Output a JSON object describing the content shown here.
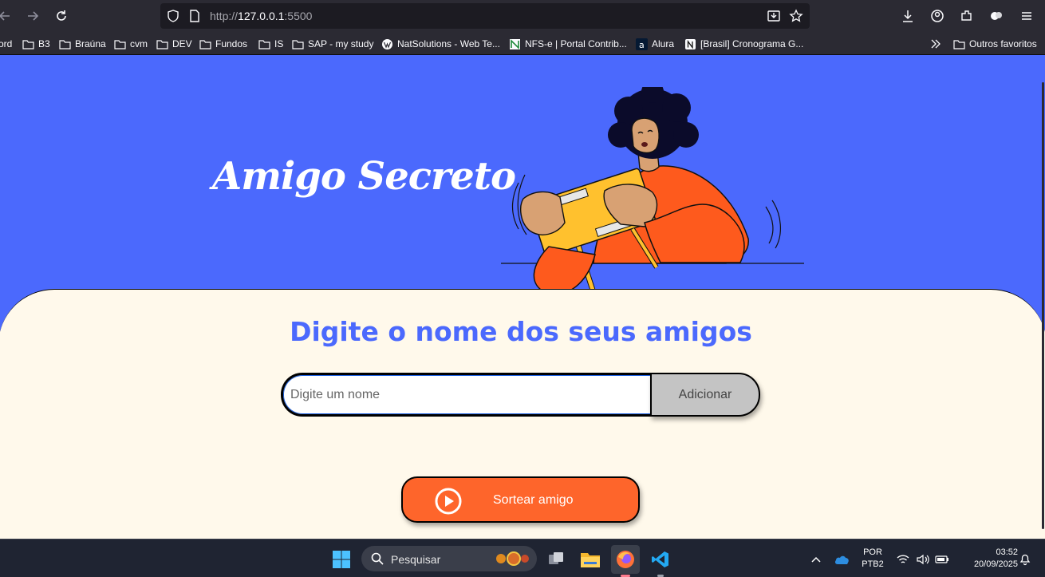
{
  "browser": {
    "url_prefix": "http://",
    "url_host": "127.0.0.1",
    "url_port": ":5500"
  },
  "bookmarks": [
    {
      "label": "ord"
    },
    {
      "label": "B3"
    },
    {
      "label": "Braúna"
    },
    {
      "label": "cvm"
    },
    {
      "label": "DEV"
    },
    {
      "label": "Fundos"
    },
    {
      "label": "IS"
    },
    {
      "label": "SAP - my study"
    },
    {
      "label": "NatSolutions - Web Te..."
    },
    {
      "label": "NFS-e | Portal Contrib..."
    },
    {
      "label": "Alura"
    },
    {
      "label": "[Brasil] Cronograma G..."
    },
    {
      "label": "Outros favoritos"
    }
  ],
  "page": {
    "title": "Amigo Secreto",
    "subtitle": "Digite o nome dos seus amigos",
    "input_placeholder": "Digite um nome",
    "input_value": "",
    "add_button": "Adicionar",
    "draw_button": "Sortear amigo"
  },
  "colors": {
    "primary": "#4b69fd",
    "background_card": "#fff9eb",
    "accent": "#fe652b",
    "add_button": "#c4c4c4"
  },
  "taskbar": {
    "search_placeholder": "Pesquisar",
    "language_top": "POR",
    "language_bottom": "PTB2",
    "time": "03:52",
    "date": "20/09/2025"
  }
}
